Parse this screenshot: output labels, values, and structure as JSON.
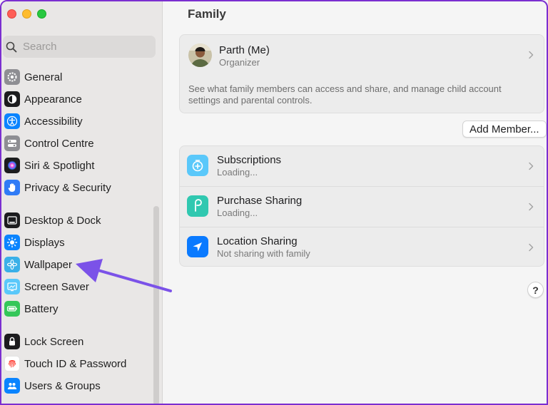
{
  "window": {
    "traffic_lights": [
      "close",
      "minimize",
      "zoom"
    ]
  },
  "sidebar": {
    "search_placeholder": "Search",
    "items": [
      {
        "label": "General",
        "icon": "gear-icon",
        "color": "#8e8e93"
      },
      {
        "label": "Appearance",
        "icon": "appearance-icon",
        "color": "#1c1c1e"
      },
      {
        "label": "Accessibility",
        "icon": "accessibility-icon",
        "color": "#0a84ff"
      },
      {
        "label": "Control Centre",
        "icon": "control-centre-icon",
        "color": "#8e8e93"
      },
      {
        "label": "Siri & Spotlight",
        "icon": "siri-icon",
        "color": "#6b3fd8"
      },
      {
        "label": "Privacy & Security",
        "icon": "hand-icon",
        "color": "#2f7bf6"
      },
      {
        "label": "Desktop & Dock",
        "icon": "dock-icon",
        "color": "#1c1c1e"
      },
      {
        "label": "Displays",
        "icon": "sun-icon",
        "color": "#0a84ff"
      },
      {
        "label": "Wallpaper",
        "icon": "flower-icon",
        "color": "#3ab0e8"
      },
      {
        "label": "Screen Saver",
        "icon": "screen-saver-icon",
        "color": "#5ac8fa"
      },
      {
        "label": "Battery",
        "icon": "battery-icon",
        "color": "#34c759"
      },
      {
        "label": "Lock Screen",
        "icon": "lock-icon",
        "color": "#1c1c1e"
      },
      {
        "label": "Touch ID & Password",
        "icon": "fingerprint-icon",
        "color": "#ff3b30"
      },
      {
        "label": "Users & Groups",
        "icon": "users-icon",
        "color": "#0a84ff"
      }
    ]
  },
  "main": {
    "title": "Family",
    "member": {
      "name": "Parth (Me)",
      "role": "Organizer",
      "description": "See what family members can access and share, and manage child account settings and parental controls."
    },
    "add_member_label": "Add Member...",
    "services": [
      {
        "title": "Subscriptions",
        "subtitle": "Loading...",
        "icon": "subscriptions-icon",
        "color": "#5ac8fa"
      },
      {
        "title": "Purchase Sharing",
        "subtitle": "Loading...",
        "icon": "purchase-sharing-icon",
        "color": "#30c8b0"
      },
      {
        "title": "Location Sharing",
        "subtitle": "Not sharing with family",
        "icon": "location-arrow-icon",
        "color": "#0a7aff"
      }
    ],
    "help_label": "?"
  },
  "annotation": {
    "arrow_color": "#7b52e8",
    "points_to": "Wallpaper"
  }
}
